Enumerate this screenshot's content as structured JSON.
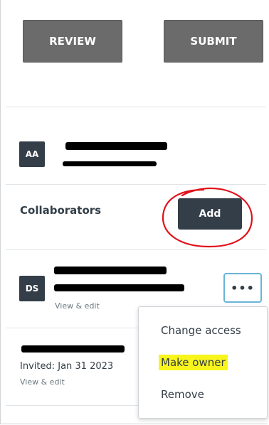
{
  "toolbar": {
    "review_label": "REVIEW",
    "submit_label": "SUBMIT"
  },
  "owner": {
    "initials": "AA"
  },
  "collaborators": {
    "title": "Collaborators",
    "add_label": "Add",
    "members": [
      {
        "initials": "DS",
        "permission": "View & edit"
      }
    ],
    "invited": [
      {
        "invited_text": "Invited: Jan 31 2023",
        "permission": "View & edit"
      }
    ]
  },
  "menu": {
    "more_label": "•••",
    "items": [
      "Change access",
      "Make owner",
      "Remove"
    ],
    "highlighted_item": "Make owner"
  },
  "colors": {
    "dark": "#333e48",
    "gray_button": "#6b6b6b",
    "annotation_red": "#e0101a",
    "highlight_yellow": "#f8f51c",
    "focus_blue": "#68b4d8"
  }
}
